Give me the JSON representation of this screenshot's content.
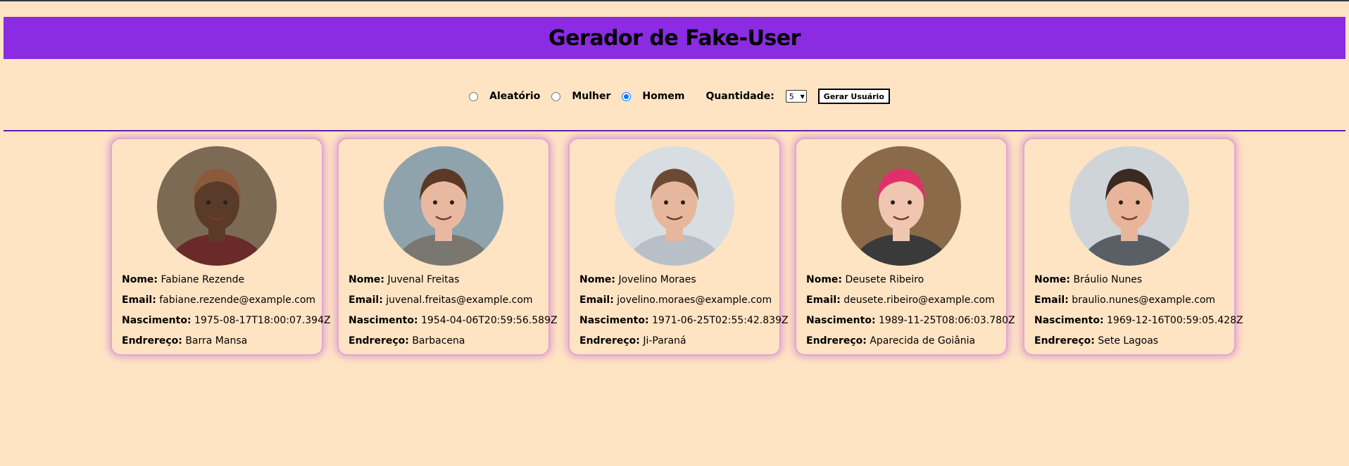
{
  "header": {
    "title": "Gerador de Fake-User"
  },
  "controls": {
    "options": [
      {
        "label": "Aleatório",
        "checked": false
      },
      {
        "label": "Mulher",
        "checked": false
      },
      {
        "label": "Homem",
        "checked": true
      }
    ],
    "quantity_label": "Quantidade:",
    "quantity_value": "5",
    "generate_button": "Gerar Usuário"
  },
  "labels": {
    "name": "Nome:",
    "email": "Email:",
    "birth": "Nascimento:",
    "address": "Endrereço:"
  },
  "users": [
    {
      "name": "Fabiane Rezende",
      "email": "fabiane.rezende@example.com",
      "birth": "1975-08-17T18:00:07.394Z",
      "address": "Barra Mansa",
      "photo_colors": {
        "bg": "#7d6a55",
        "skin": "#5a3a28",
        "hair": "#8a5a3a",
        "shirt": "#6a2a2a"
      }
    },
    {
      "name": "Juvenal Freitas",
      "email": "juvenal.freitas@example.com",
      "birth": "1954-04-06T20:59:56.589Z",
      "address": "Barbacena",
      "photo_colors": {
        "bg": "#8fa3ad",
        "skin": "#e8b9a0",
        "hair": "#5a3a24",
        "shirt": "#7a7670"
      }
    },
    {
      "name": "Jovelino Moraes",
      "email": "jovelino.moraes@example.com",
      "birth": "1971-06-25T02:55:42.839Z",
      "address": "Ji-Paraná",
      "photo_colors": {
        "bg": "#d8dde2",
        "skin": "#e6b79c",
        "hair": "#6b4a34",
        "shirt": "#b9bfc6"
      }
    },
    {
      "name": "Deusete Ribeiro",
      "email": "deusete.ribeiro@example.com",
      "birth": "1989-11-25T08:06:03.780Z",
      "address": "Aparecida de Goiânia",
      "photo_colors": {
        "bg": "#8b6a4a",
        "skin": "#f0c6b0",
        "hair": "#e0306a",
        "shirt": "#3a3a3a"
      }
    },
    {
      "name": "Bráulio Nunes",
      "email": "braulio.nunes@example.com",
      "birth": "1969-12-16T00:59:05.428Z",
      "address": "Sete Lagoas",
      "photo_colors": {
        "bg": "#cfd4d8",
        "skin": "#e8b49a",
        "hair": "#3a2a22",
        "shirt": "#5a5f66"
      }
    }
  ]
}
